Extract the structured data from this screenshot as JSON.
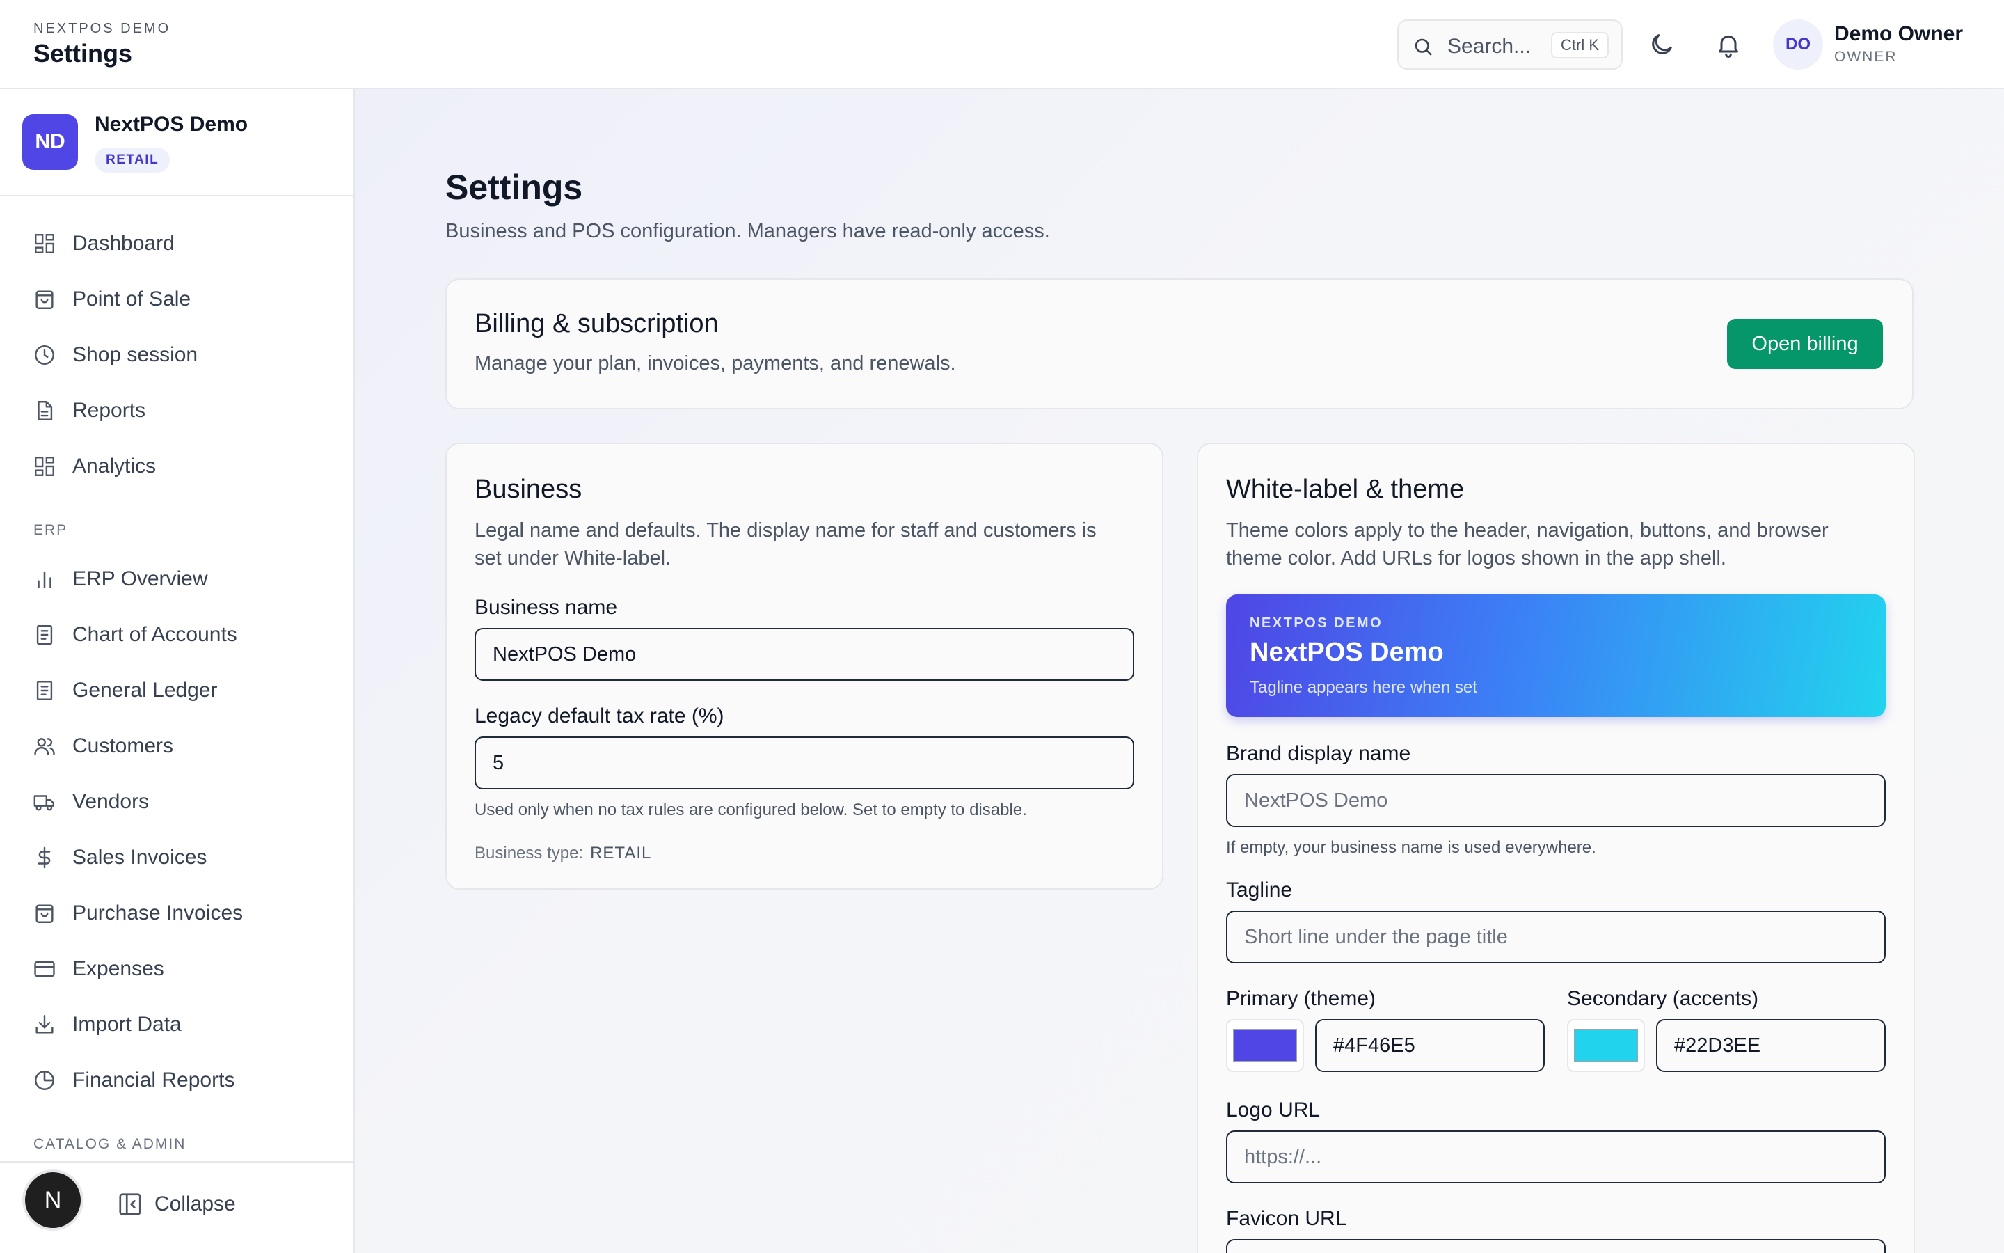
{
  "topbar": {
    "eyebrow": "NEXTPOS DEMO",
    "title": "Settings",
    "search_placeholder": "Search...",
    "search_shortcut": "Ctrl K",
    "user_initials": "DO",
    "user_name": "Demo Owner",
    "user_role": "OWNER"
  },
  "sidebar": {
    "business_initials": "ND",
    "business_name": "NextPOS Demo",
    "business_badge": "RETAIL",
    "items": [
      {
        "label": "Dashboard",
        "icon": "dashboard-icon"
      },
      {
        "label": "Point of Sale",
        "icon": "shopping-bag-icon"
      },
      {
        "label": "Shop session",
        "icon": "clock-icon"
      },
      {
        "label": "Reports",
        "icon": "document-icon"
      },
      {
        "label": "Analytics",
        "icon": "dashboard-icon"
      }
    ],
    "section_erp": "ERP",
    "erp_items": [
      {
        "label": "ERP Overview",
        "icon": "bar-chart-icon"
      },
      {
        "label": "Chart of Accounts",
        "icon": "book-icon"
      },
      {
        "label": "General Ledger",
        "icon": "book-icon"
      },
      {
        "label": "Customers",
        "icon": "users-icon"
      },
      {
        "label": "Vendors",
        "icon": "truck-icon"
      },
      {
        "label": "Sales Invoices",
        "icon": "dollar-icon"
      },
      {
        "label": "Purchase Invoices",
        "icon": "shopping-bag-icon"
      },
      {
        "label": "Expenses",
        "icon": "credit-card-icon"
      },
      {
        "label": "Import Data",
        "icon": "download-icon"
      },
      {
        "label": "Financial Reports",
        "icon": "pie-chart-icon"
      }
    ],
    "section_catalog": "CATALOG & ADMIN",
    "floating_badge": "N",
    "collapse_label": "Collapse"
  },
  "main": {
    "title": "Settings",
    "subtitle": "Business and POS configuration. Managers have read-only access.",
    "billing": {
      "title": "Billing & subscription",
      "description": "Manage your plan, invoices, payments, and renewals.",
      "button": "Open billing"
    },
    "business": {
      "title": "Business",
      "description_line1": "Legal name and defaults. The display name for staff and customers is",
      "description_line2": "set under White-label.",
      "name_label": "Business name",
      "name_value": "NextPOS Demo",
      "tax_label": "Legacy default tax rate (%)",
      "tax_value": "5",
      "tax_hint": "Used only when no tax rules are configured below. Set to empty to disable.",
      "type_label": "Business type:",
      "type_value": "RETAIL"
    },
    "whitelabel": {
      "title": "White-label & theme",
      "description_line1": "Theme colors apply to the header, navigation, buttons, and browser",
      "description_line2": "theme color. Add URLs for logos shown in the app shell.",
      "preview_eyebrow": "NEXTPOS DEMO",
      "preview_name": "NextPOS Demo",
      "preview_tagline": "Tagline appears here when set",
      "brand_label": "Brand display name",
      "brand_placeholder": "NextPOS Demo",
      "brand_hint": "If empty, your business name is used everywhere.",
      "tagline_label": "Tagline",
      "tagline_placeholder": "Short line under the page title",
      "primary_label": "Primary (theme)",
      "primary_value": "#4F46E5",
      "secondary_label": "Secondary (accents)",
      "secondary_value": "#22D3EE",
      "logo_label": "Logo URL",
      "logo_placeholder": "https://...",
      "favicon_label": "Favicon URL"
    }
  },
  "colors": {
    "accent": "#4F46E5",
    "secondary": "#22D3EE",
    "billing_button": "#059669"
  }
}
